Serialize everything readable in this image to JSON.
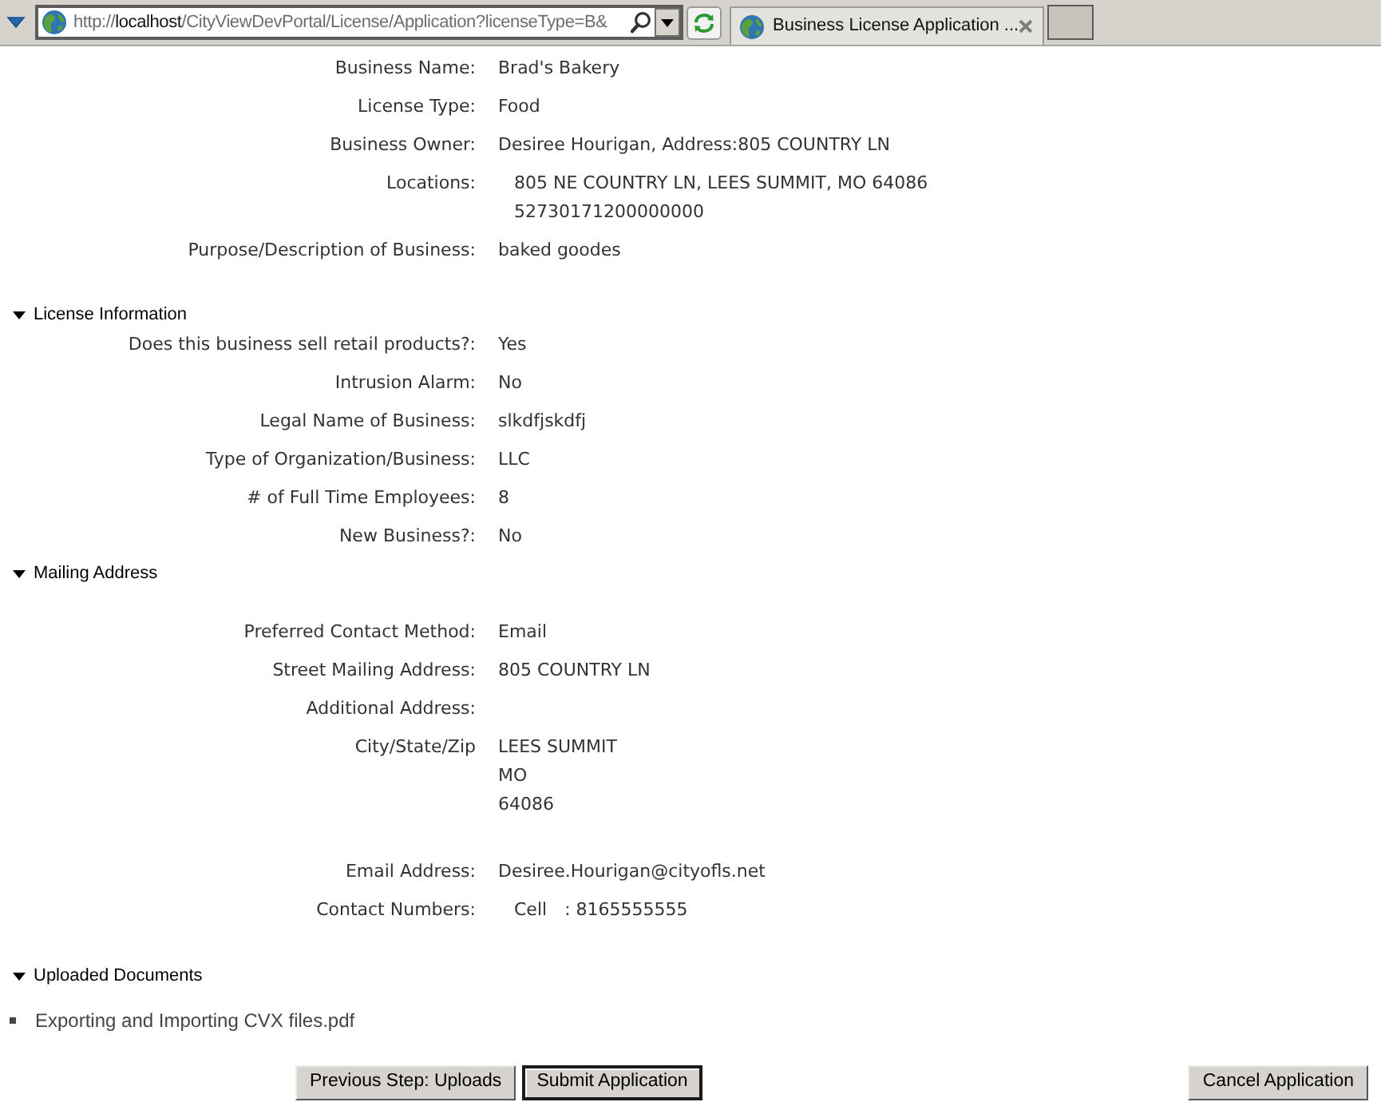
{
  "browser": {
    "address_bar": {
      "scheme": "http://",
      "host": "localhost",
      "path": "/CityViewDevPortal/License/Application?licenseType=B&"
    },
    "tab": {
      "title": "Business License Application ..."
    }
  },
  "summary": [
    {
      "kind": "text",
      "label": "Business Name:",
      "value": "Brad's Bakery"
    },
    {
      "kind": "text",
      "label": "License Type:",
      "value": "Food"
    },
    {
      "kind": "text",
      "label": "Business Owner:",
      "value": "Desiree Hourigan, Address:805 COUNTRY LN"
    },
    {
      "kind": "list",
      "label": "Locations:",
      "lines": [
        "805 NE COUNTRY LN, LEES SUMMIT, MO 64086",
        "52730171200000000"
      ]
    },
    {
      "kind": "text",
      "label": "Purpose/Description of Business:",
      "value": "baked goodes"
    }
  ],
  "sections": [
    {
      "kind": "fields",
      "title": "License Information",
      "expanded": true,
      "fields": [
        {
          "kind": "text",
          "label": "Does this business sell retail products?:",
          "value": "Yes"
        },
        {
          "kind": "text",
          "label": "Intrusion Alarm:",
          "value": "No"
        },
        {
          "kind": "text",
          "label": "Legal Name of Business:",
          "value": "slkdfjskdfj"
        },
        {
          "kind": "text",
          "label": "Type of Organization/Business:",
          "value": "LLC"
        },
        {
          "kind": "text",
          "label": "# of Full Time Employees:",
          "value": "8"
        },
        {
          "kind": "text",
          "label": "New Business?:",
          "value": "No"
        }
      ]
    },
    {
      "kind": "address",
      "title": "Mailing Address",
      "expanded": true,
      "fields": [
        {
          "kind": "text",
          "label": "Preferred Contact Method:",
          "value": "Email"
        },
        {
          "kind": "text",
          "label": "Street Mailing Address:",
          "value": "805 COUNTRY LN"
        },
        {
          "kind": "text",
          "label": "Additional Address:"
        },
        {
          "kind": "address",
          "label": "City/State/Zip",
          "lines": [
            "LEES SUMMIT",
            "MO",
            "64086"
          ]
        },
        {
          "kind": "text",
          "label": "Email Address:",
          "value": "Desiree.Hourigan@cityofls.net"
        },
        {
          "kind": "phones",
          "label": "Contact Numbers:",
          "phones": [
            {
              "type": "Cell",
              "number": ": 8165555555"
            }
          ]
        }
      ]
    },
    {
      "kind": "documents",
      "title": "Uploaded Documents",
      "expanded": true,
      "documents": [
        "Exporting and Importing CVX files.pdf"
      ]
    }
  ],
  "step_buttons": [
    {
      "label": "Previous Step: Uploads",
      "default": false
    },
    {
      "label": "Submit Application",
      "default": true
    }
  ],
  "cancel_button": {
    "label": "Cancel Application",
    "default": false
  }
}
